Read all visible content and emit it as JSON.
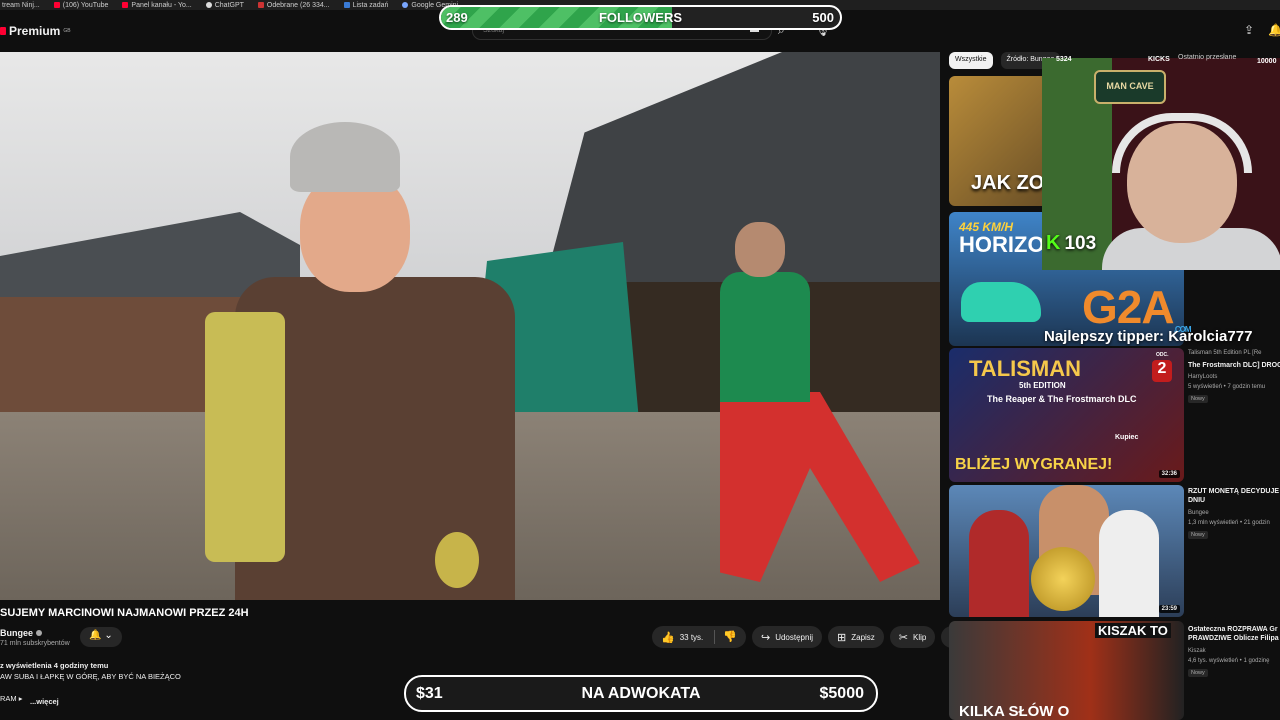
{
  "bookmarks": [
    "tream Ninj...",
    "(106) YouTube",
    "Panel kanału - Yo...",
    "ChatGPT",
    "Odebrane (26 334...",
    "Lista zadań",
    "Google Gemini"
  ],
  "header": {
    "logo_text": "Premium",
    "logo_region": "GB",
    "search_placeholder": "Szukaj"
  },
  "followers": {
    "start": "289",
    "label": "FOLLOWERS",
    "end": "500",
    "progress": 0.58
  },
  "video": {
    "title": "SUJEMY MARCINOWI NAJMANOWI PRZEZ 24H",
    "channel": "Bungee",
    "subscribers": "71 mln subskrybentów",
    "likes": "33 tys.",
    "actions": {
      "share": "Udostępnij",
      "save": "Zapisz",
      "clip": "Klip"
    },
    "description": {
      "line1": "z wyświetlenia  4 godziny temu",
      "line2": "AW SUBA I ŁAPKĘ W GÓRĘ, ABY BYĆ NA BIEŻĄCO",
      "line3": "RAM  ▸",
      "more": "...więcej"
    }
  },
  "donation": {
    "start": "$31",
    "label": "NA ADWOKATA",
    "end": "$5000"
  },
  "chips": [
    "Wszystkie",
    "Źródło: Bungee"
  ],
  "overlay": {
    "top_count": "5324",
    "top_kicks": "KICKS",
    "top_recent": "Ostatnio przesłane",
    "top_goal": "10000",
    "mancave": "MAN CAVE",
    "kicks": "103",
    "sponsor": "G2A",
    "sponsor_domain": ".COM",
    "tipper": "Najlepszy tipper: Karolcia777"
  },
  "recommendations": [
    {
      "title": "",
      "thumb_text": "JAK ZOST"
    },
    {
      "title": "",
      "thumb_text": "HORIZO",
      "thumb_badge": "445 KM/H"
    },
    {
      "title": "The Frostmarch DLC] DROG",
      "channel": "HarryLoots",
      "meta": "5 wyświetleń • 7 godzin temu",
      "badge": "Nowy",
      "duration": "32:36",
      "thumb_title": "TALISMAN",
      "thumb_sub": "5th EDITION",
      "thumb_dlc": "The Reaper & The Frostmarch DLC",
      "thumb_bottom": "BLIŻEJ WYGRANEJ!",
      "thumb_ep_label": "ODC.",
      "thumb_ep": "2",
      "thumb_kupiec": "Kupiec",
      "above_title": "Talisman 5th Edition PL [Re"
    },
    {
      "title": "RZUT MONETĄ DECYDUJE DNIU",
      "channel": "Bungee",
      "meta": "1,3 mln wyświetleń • 21 godzin",
      "badge": "Nowy",
      "duration": "23:59"
    },
    {
      "title": "Ostateczna ROZPRAWA Gr PRAWDZIWE Oblicze Filipa",
      "channel": "Kiszak",
      "meta": "4,6 tys. wyświetleń • 1 godzinę",
      "badge": "Nowy",
      "thumb_title": "KISZAK TO",
      "thumb_bottom": "KILKA SŁÓW O"
    }
  ],
  "colors": {
    "accent": "#ff0033",
    "followers_fill": "#4ec065",
    "kick_green": "#53fc18",
    "g2a_orange": "#f08a2c"
  }
}
